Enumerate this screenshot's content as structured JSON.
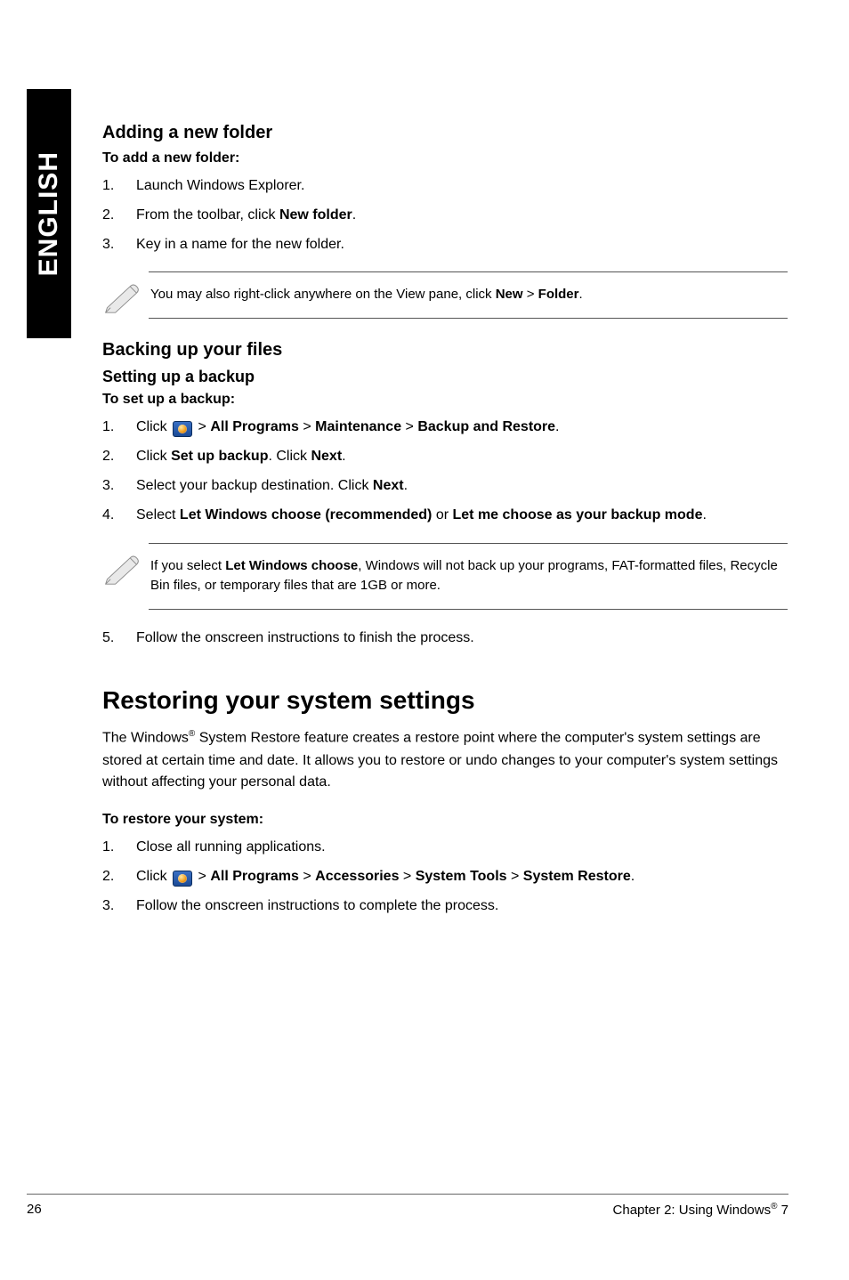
{
  "locale_tab": "ENGLISH",
  "sec1": {
    "heading": "Adding a new folder",
    "subheading": "To add a new folder:",
    "steps": [
      {
        "num": "1.",
        "text": "Launch Windows Explorer."
      },
      {
        "num": "2.",
        "pre": "From the toolbar, click ",
        "b1": "New folder",
        "post": "."
      },
      {
        "num": "3.",
        "text": "Key in a name for the new folder."
      }
    ],
    "note_pre": "You may also right-click anywhere on the View pane, click ",
    "note_b1": "New",
    "note_mid": " > ",
    "note_b2": "Folder",
    "note_post": "."
  },
  "sec2": {
    "heading": "Backing up your files",
    "subheading": "Setting up a backup",
    "lead": "To set up a backup:",
    "step1": {
      "num": "1.",
      "pre": "Click ",
      "mid": " > ",
      "b1": "All Programs",
      "b2": "Maintenance",
      "b3": "Backup and Restore",
      "post": "."
    },
    "step2": {
      "num": "2.",
      "pre": "Click ",
      "b1": "Set up backup",
      "mid": ". Click ",
      "b2": "Next",
      "post": "."
    },
    "step3": {
      "num": "3.",
      "pre": "Select your backup destination. Click ",
      "b1": "Next",
      "post": "."
    },
    "step4": {
      "num": "4.",
      "pre": "Select ",
      "b1": "Let Windows choose (recommended)",
      "mid": " or ",
      "b2": "Let me choose as your backup mode",
      "post": "."
    },
    "note_pre": "If you select ",
    "note_b1": "Let Windows choose",
    "note_post": ", Windows will not back up your programs, FAT-formatted files, Recycle Bin files, or temporary files that are 1GB or more.",
    "step5": {
      "num": "5.",
      "text": "Follow the onscreen instructions to finish the process."
    }
  },
  "sec3": {
    "heading": "Restoring your system settings",
    "para_pre": "The Windows",
    "para_sup": "®",
    "para_post": " System Restore feature creates a restore point where the computer's system settings are stored at certain time and date. It allows you to restore or undo changes to your computer's system settings without affecting your personal data.",
    "lead": "To restore your system:",
    "step1": {
      "num": "1.",
      "text": "Close all running applications."
    },
    "step2": {
      "num": "2.",
      "pre": "Click ",
      "mid": " > ",
      "b1": "All Programs",
      "b2": "Accessories",
      "b3": "System Tools",
      "b4": "System Restore",
      "post": "."
    },
    "step3": {
      "num": "3.",
      "text": "Follow the onscreen instructions to complete the process."
    }
  },
  "footer": {
    "page": "26",
    "chapter_pre": "Chapter 2: Using Windows",
    "chapter_sup": "®",
    "chapter_post": " 7"
  }
}
